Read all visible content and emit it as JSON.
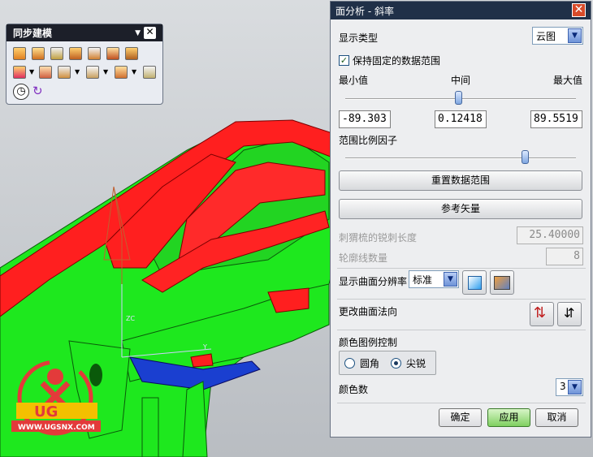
{
  "toolbar": {
    "title": "同步建模",
    "icons": [
      "move-face-icon",
      "pull-face-icon",
      "offset-region-icon",
      "replace-face-icon",
      "resize-blend-icon",
      "delete-face-icon",
      "make-coplanar-icon",
      "copy-face-icon",
      "dropdown-icon",
      "paste-face-icon",
      "mirror-face-icon",
      "dropdown-icon",
      "linear-dimension-icon",
      "dropdown-icon",
      "cross-section-icon",
      "history-clock-icon",
      "refresh-icon"
    ]
  },
  "viewport": {
    "watermark_brand": "UG",
    "watermark_site": "WWW.UGSNX.COM",
    "colors": {
      "background": "#c8ccd0",
      "steep": "#ff1a1a",
      "flat": "#1aee1a",
      "negative": "#1020c0"
    }
  },
  "dialog": {
    "title": "面分析 - 斜率",
    "display_type_label": "显示类型",
    "display_type_value": "云图",
    "keep_range_label": "保持固定的数据范围",
    "keep_range_checked": true,
    "min_label": "最小值",
    "mid_label": "中间",
    "max_label": "最大值",
    "min_value": "-89.303",
    "mid_value": "0.12418",
    "max_value": "89.5519",
    "mid_slider_fraction": 0.49,
    "range_scale_label": "范围比例因子",
    "range_scale_fraction": 0.78,
    "reset_button": "重置数据范围",
    "ref_vector_button": "参考矢量",
    "hedgehog_label": "刺猬梳的锐刺长度",
    "hedgehog_value": "25.40000",
    "contour_label": "轮廓线数量",
    "contour_value": "8",
    "resolution_label": "显示曲面分辨率",
    "resolution_value": "标准",
    "change_normal_label": "更改曲面法向",
    "legend_group_label": "颜色图例控制",
    "radio_round": "圆角",
    "radio_sharp": "尖锐",
    "color_count_label": "颜色数",
    "color_count_value": "3",
    "ok_button": "确定",
    "apply_button": "应用",
    "cancel_button": "取消",
    "close_icon": "close-icon"
  }
}
